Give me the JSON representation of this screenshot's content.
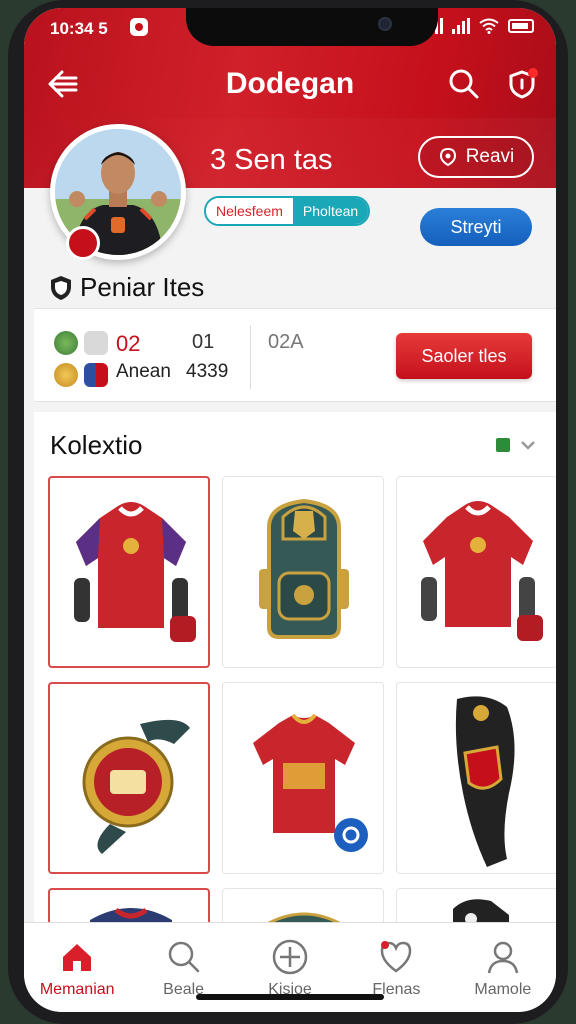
{
  "status_bar": {
    "time": "10:34 5"
  },
  "header": {
    "title": "Dodegan",
    "stat_count": "3 Sen tas",
    "reavi_label": "Reavi",
    "pill_left": "Nelesfeem",
    "pill_right": "Pholtean",
    "stryi_label": "Streyti"
  },
  "section": {
    "title": "Peniar Ites"
  },
  "stats": {
    "value_red": "02",
    "value_01": "01",
    "value_02a": "02A",
    "anon_label": "Anean",
    "anon_value": "4339",
    "sadler_label": "Saoler tles"
  },
  "collection": {
    "title": "Kolextio",
    "items": [
      "Red jersey with gloves",
      "Green backpack",
      "Red jersey with gloves",
      "Gold watch",
      "Red shirt",
      "Black shin guard"
    ]
  },
  "nav": [
    {
      "label": "Memanian",
      "icon": "home-icon",
      "active": true
    },
    {
      "label": "Beale",
      "icon": "search-icon",
      "active": false
    },
    {
      "label": "Kisioe",
      "icon": "plus-circle-icon",
      "active": false
    },
    {
      "label": "Flenas",
      "icon": "heart-icon",
      "active": false
    },
    {
      "label": "Mamole",
      "icon": "profile-icon",
      "active": false
    }
  ],
  "colors": {
    "brand_red": "#c5101c",
    "accent_blue": "#1560bd",
    "teal": "#1aa7b8"
  }
}
